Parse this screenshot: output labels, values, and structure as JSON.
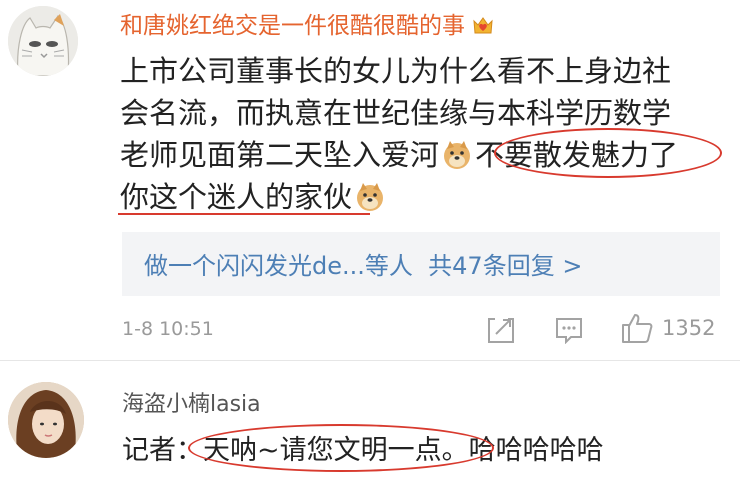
{
  "comment": {
    "username": "和唐姚红绝交是一件很酷很酷的事",
    "badge_icon": "crown-heart-icon",
    "lines": [
      "上市公司董事长的女儿为什么看不上身边社",
      "会名流，而执意在世纪佳缘与本科学历数学",
      "老师见面第二天坠入爱河",
      "不要散发魅力了",
      "你这个迷人的家伙"
    ],
    "emoji": "doge-emoji",
    "replies": {
      "preview": "做一个闪闪发光de...等人",
      "count_text": "共47条回复 >"
    },
    "time": "1-8 10:51",
    "like_count": "1352"
  },
  "reply": {
    "username": "海盗小楠lasia",
    "prefix": "记者：",
    "highlight": "天呐~请您文明一点",
    "suffix": "。哈哈哈哈哈"
  },
  "colors": {
    "username": "#e5642f",
    "link": "#4d7fb5",
    "annotation": "#d83a2e",
    "muted": "#9a9a9a"
  }
}
